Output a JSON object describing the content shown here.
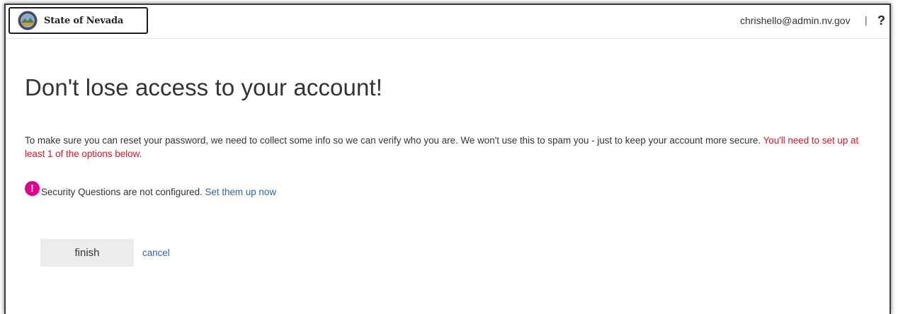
{
  "header": {
    "org_name": "State of Nevada",
    "logo_icon": "state-seal-icon",
    "user_email": "chrishello@admin.nv.gov",
    "separator": "|",
    "help_label": "?"
  },
  "main": {
    "title": "Don't lose access to your account!",
    "intro_text": "To make sure you can reset your password, we need to collect some info so we can verify who you are. We won't use this to spam you - just to keep your account more secure.",
    "intro_warning": "You'll need to set up at least 1 of the options below.",
    "status": {
      "icon": "alert-icon",
      "text": "Security Questions are not configured.",
      "link_label": "Set them up now"
    }
  },
  "actions": {
    "finish_label": "finish",
    "cancel_label": "cancel"
  },
  "colors": {
    "warning": "#e81123",
    "alert_icon": "#e3008c",
    "link": "#2e62b3"
  }
}
